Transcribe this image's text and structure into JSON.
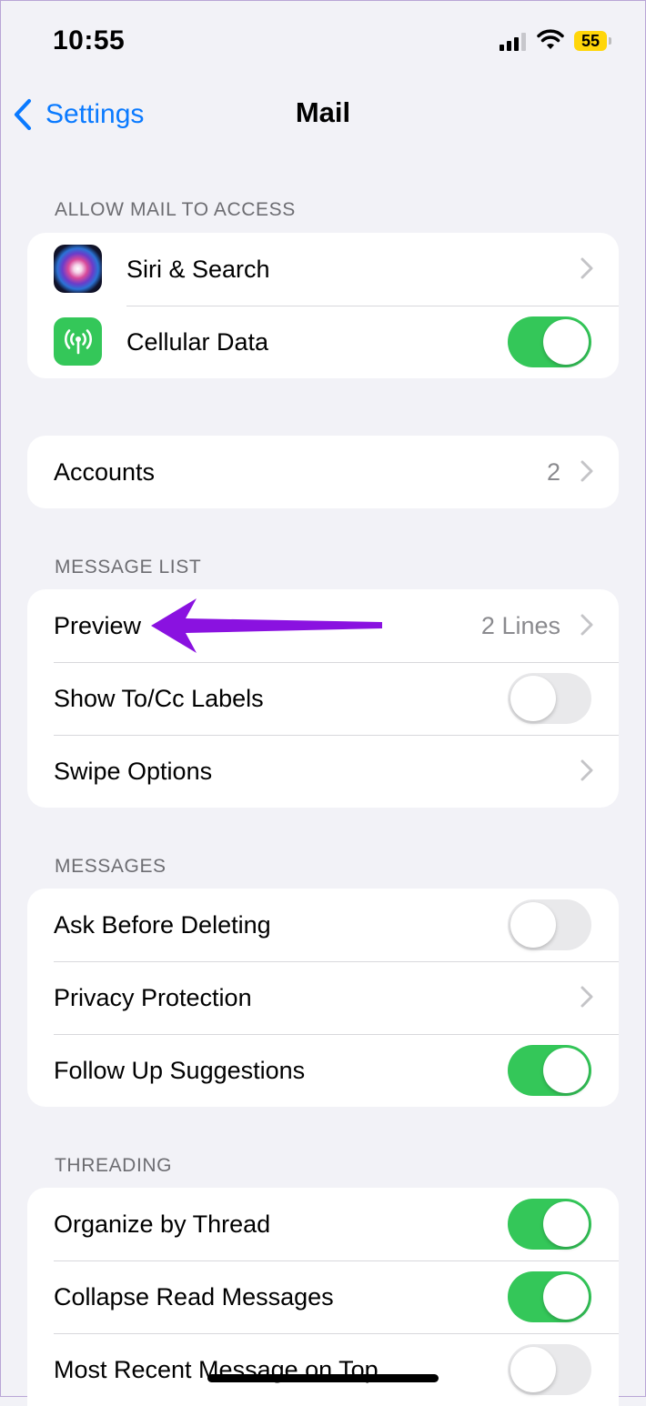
{
  "status_bar": {
    "time": "10:55",
    "battery_level": "55",
    "battery_color": "#ffd60a"
  },
  "nav": {
    "back_label": "Settings",
    "title": "Mail",
    "accent_color": "#0a7aff"
  },
  "sections": {
    "allow_access": {
      "header": "ALLOW MAIL TO ACCESS",
      "siri_search": {
        "label": "Siri & Search",
        "icon": "siri-icon"
      },
      "cellular_data": {
        "label": "Cellular Data",
        "icon": "antenna-icon",
        "enabled": true
      }
    },
    "accounts": {
      "label": "Accounts",
      "value": "2"
    },
    "message_list": {
      "header": "MESSAGE LIST",
      "preview": {
        "label": "Preview",
        "value": "2 Lines"
      },
      "show_to_cc": {
        "label": "Show To/Cc Labels",
        "enabled": false
      },
      "swipe_options": {
        "label": "Swipe Options"
      }
    },
    "messages": {
      "header": "MESSAGES",
      "ask_before_deleting": {
        "label": "Ask Before Deleting",
        "enabled": false
      },
      "privacy_protection": {
        "label": "Privacy Protection"
      },
      "follow_up": {
        "label": "Follow Up Suggestions",
        "enabled": true
      }
    },
    "threading": {
      "header": "THREADING",
      "organize_by_thread": {
        "label": "Organize by Thread",
        "enabled": true
      },
      "collapse_read": {
        "label": "Collapse Read Messages",
        "enabled": true
      },
      "most_recent_on_top": {
        "label": "Most Recent Message on Top",
        "enabled": false
      }
    }
  },
  "annotation": {
    "icon": "purple-arrow-icon",
    "color": "#8a12e0"
  },
  "toggle_on_color": "#34c759"
}
